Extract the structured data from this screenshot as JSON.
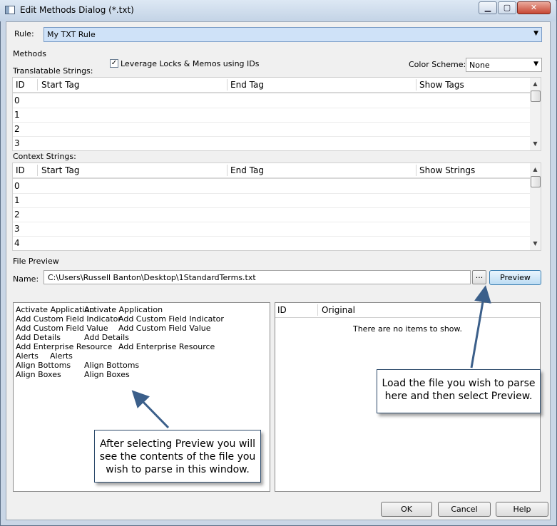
{
  "window": {
    "title": "Edit Methods Dialog (*.txt)",
    "min_glyph": "▁",
    "max_glyph": "▢",
    "close_glyph": "✕"
  },
  "rule": {
    "label": "Rule:",
    "value": "My TXT Rule"
  },
  "methods": {
    "label": "Methods",
    "leverage_checked": true,
    "leverage_check_glyph": "✓",
    "leverage_label": "Leverage Locks & Memos using IDs",
    "color_scheme_label": "Color Scheme:",
    "color_scheme_value": "None"
  },
  "translatable": {
    "label": "Translatable Strings:",
    "columns": [
      "ID",
      "Start Tag",
      "End Tag",
      "Show Tags"
    ],
    "rows": [
      "0",
      "1",
      "2",
      "3"
    ]
  },
  "context": {
    "label": "Context Strings:",
    "columns": [
      "ID",
      "Start Tag",
      "End Tag",
      "Show Strings"
    ],
    "rows": [
      "0",
      "1",
      "2",
      "3",
      "4"
    ]
  },
  "file_preview": {
    "label": "File Preview",
    "name_label": "Name:",
    "path": "C:\\Users\\Russell Banton\\Desktop\\1StandardTerms.txt",
    "browse_label": "...",
    "preview_label": "Preview",
    "text_lines": [
      [
        "Activate Application",
        "Activate Application"
      ],
      [
        "Add Custom Field Indicator",
        "Add Custom Field Indicator"
      ],
      [
        "Add Custom Field Value",
        "Add Custom Field Value"
      ],
      [
        "Add Details",
        "Add Details"
      ],
      [
        "Add Enterprise Resource",
        "Add Enterprise Resource"
      ],
      [
        "Alerts",
        "Alerts"
      ],
      [
        "Align Bottoms",
        "Align Bottoms"
      ],
      [
        "Align Boxes",
        "Align Boxes"
      ]
    ],
    "list_columns": [
      "ID",
      "Original"
    ],
    "empty_text": "There are no items to show."
  },
  "buttons": {
    "ok": "OK",
    "cancel": "Cancel",
    "help": "Help"
  },
  "callouts": {
    "load": "Load the file you wish to parse here and then select Preview.",
    "preview": "After selecting Preview you will see the contents of the file you wish to parse in this window."
  },
  "colors": {
    "callout_arrow": "#3b5f8a",
    "rule_highlight": "#cfe2f8"
  }
}
